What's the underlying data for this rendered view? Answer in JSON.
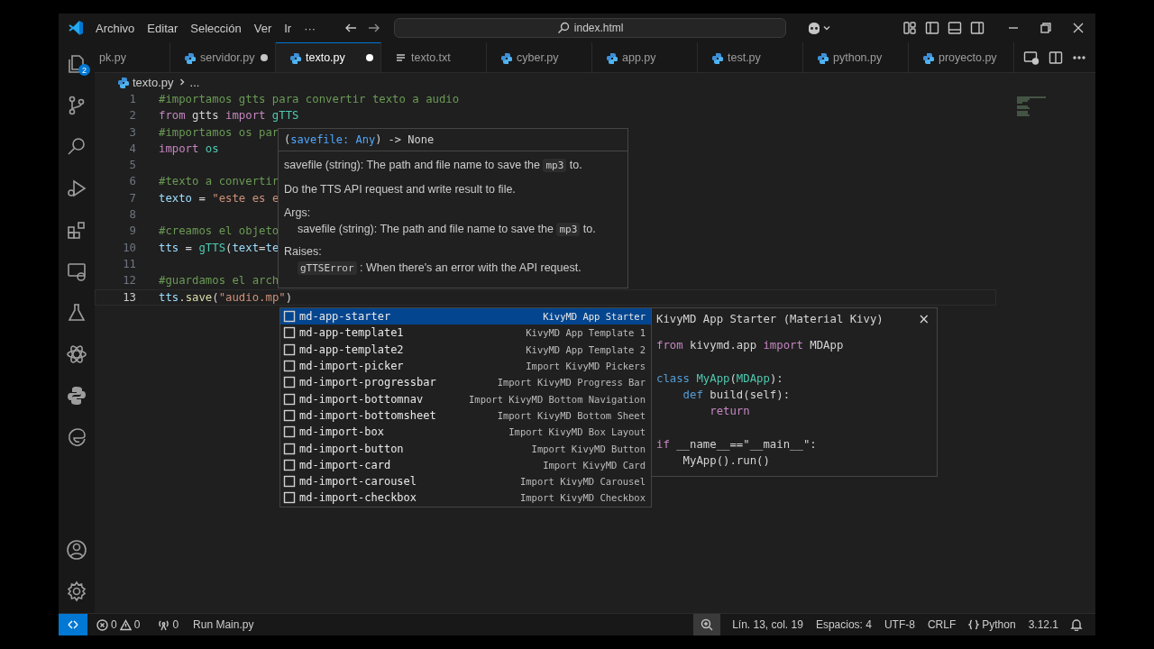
{
  "title_bar": {
    "menu": [
      "Archivo",
      "Editar",
      "Selección",
      "Ver",
      "Ir",
      "···"
    ],
    "search": {
      "value": "index.html"
    }
  },
  "activity_bar": {
    "explorer_badge": "2"
  },
  "tabs": [
    {
      "label": "pk.py",
      "kind": "clipped",
      "selected": false,
      "modified": false
    },
    {
      "label": "servidor.py",
      "kind": "python",
      "selected": false,
      "modified": true
    },
    {
      "label": "texto.py",
      "kind": "python",
      "selected": true,
      "modified": true
    },
    {
      "label": "texto.txt",
      "kind": "text",
      "selected": false,
      "modified": false
    },
    {
      "label": "cyber.py",
      "kind": "python",
      "selected": false,
      "modified": false
    },
    {
      "label": "app.py",
      "kind": "python",
      "selected": false,
      "modified": false
    },
    {
      "label": "test.py",
      "kind": "python",
      "selected": false,
      "modified": false
    },
    {
      "label": "python.py",
      "kind": "python",
      "selected": false,
      "modified": false
    },
    {
      "label": "proyecto.py",
      "kind": "python",
      "selected": false,
      "modified": false
    }
  ],
  "breadcrumb": [
    "texto.py",
    "..."
  ],
  "editor": {
    "lines": [
      {
        "number": "1",
        "active": false,
        "tokens": [
          {
            "text": "#importamos gtts para convertir texto a audio",
            "kind": "comment"
          }
        ]
      },
      {
        "number": "2",
        "active": false,
        "tokens": [
          {
            "text": "from",
            "kind": "keyword"
          },
          {
            "text": " gtts ",
            "kind": "plain"
          },
          {
            "text": "import",
            "kind": "keyword"
          },
          {
            "text": " gTTS",
            "kind": "class"
          }
        ]
      },
      {
        "number": "3",
        "active": false,
        "tokens": [
          {
            "text": "#importamos os par",
            "kind": "comment"
          }
        ]
      },
      {
        "number": "4",
        "active": false,
        "tokens": [
          {
            "text": "import",
            "kind": "keyword"
          },
          {
            "text": " os",
            "kind": "class"
          }
        ]
      },
      {
        "number": "5",
        "active": false
      },
      {
        "number": "6",
        "active": false,
        "tokens": [
          {
            "text": "#texto a convertir",
            "kind": "comment"
          }
        ]
      },
      {
        "number": "7",
        "active": false,
        "tokens": [
          {
            "text": "texto",
            "kind": "variable"
          },
          {
            "text": " = ",
            "kind": "plain"
          },
          {
            "text": "\"este es e",
            "kind": "string"
          }
        ]
      },
      {
        "number": "8",
        "active": false
      },
      {
        "number": "9",
        "active": false,
        "tokens": [
          {
            "text": "#creamos el objeto",
            "kind": "comment"
          }
        ]
      },
      {
        "number": "10",
        "active": false,
        "tokens": [
          {
            "text": "tts",
            "kind": "variable"
          },
          {
            "text": " = ",
            "kind": "plain"
          },
          {
            "text": "gTTS",
            "kind": "class"
          },
          {
            "text": "(",
            "kind": "plain"
          },
          {
            "text": "text",
            "kind": "variable"
          },
          {
            "text": "=",
            "kind": "plain"
          },
          {
            "text": "te",
            "kind": "variable"
          }
        ]
      },
      {
        "number": "11",
        "active": false
      },
      {
        "number": "12",
        "active": false,
        "tokens": [
          {
            "text": "#guardamos el arch",
            "kind": "comment"
          }
        ]
      },
      {
        "number": "13",
        "active": true,
        "tokens": [
          {
            "text": "tts",
            "kind": "variable"
          },
          {
            "text": ".",
            "kind": "plain"
          },
          {
            "text": "save",
            "kind": "function"
          },
          {
            "text": "(",
            "kind": "plain"
          },
          {
            "text": "\"audio.mp\"",
            "kind": "string"
          },
          {
            "text": ")",
            "kind": "plain"
          }
        ]
      }
    ]
  },
  "hover": {
    "signature": [
      {
        "text": "(",
        "kind": "plain"
      },
      {
        "text": "savefile: Any",
        "kind": "param"
      },
      {
        "text": ") -> None",
        "kind": "plain"
      }
    ],
    "paragraphs": [
      {
        "kind": "text",
        "segments": [
          {
            "text": "savefile (string): The path and file name to save the ",
            "kind": "text"
          },
          {
            "text": "mp3",
            "kind": "code"
          },
          {
            "text": " to.",
            "kind": "text"
          }
        ]
      },
      {
        "kind": "text",
        "segments": [
          {
            "text": "Do the TTS API request and write result to file.",
            "kind": "text"
          }
        ]
      },
      {
        "kind": "heading",
        "segments": [
          {
            "text": "Args:",
            "kind": "text"
          }
        ]
      },
      {
        "kind": "indented",
        "segments": [
          {
            "text": "savefile (string): The path and file name to save the ",
            "kind": "text"
          },
          {
            "text": "mp3",
            "kind": "code"
          },
          {
            "text": " to.",
            "kind": "text"
          }
        ]
      },
      {
        "kind": "heading",
        "segments": [
          {
            "text": "Raises:",
            "kind": "text"
          }
        ]
      },
      {
        "kind": "indented",
        "segments": [
          {
            "text": "gTTSError",
            "kind": "code"
          },
          {
            "text": " : When there's an error with the API request.",
            "kind": "text"
          }
        ]
      }
    ]
  },
  "suggest": {
    "items": [
      {
        "label": "md-app-starter",
        "detail": "KivyMD App Starter",
        "selected": true
      },
      {
        "label": "md-app-template1",
        "detail": "KivyMD App Template 1",
        "selected": false
      },
      {
        "label": "md-app-template2",
        "detail": "KivyMD App Template 2",
        "selected": false
      },
      {
        "label": "md-import-picker",
        "detail": "Import KivyMD Pickers",
        "selected": false
      },
      {
        "label": "md-import-progressbar",
        "detail": "Import KivyMD Progress Bar",
        "selected": false
      },
      {
        "label": "md-import-bottomnav",
        "detail": "Import KivyMD Bottom Navigation",
        "selected": false
      },
      {
        "label": "md-import-bottomsheet",
        "detail": "Import KivyMD Bottom Sheet",
        "selected": false
      },
      {
        "label": "md-import-box",
        "detail": "Import KivyMD Box Layout",
        "selected": false
      },
      {
        "label": "md-import-button",
        "detail": "Import KivyMD Button",
        "selected": false
      },
      {
        "label": "md-import-card",
        "detail": "Import KivyMD Card",
        "selected": false
      },
      {
        "label": "md-import-carousel",
        "detail": "Import KivyMD Carousel",
        "selected": false
      },
      {
        "label": "md-import-checkbox",
        "detail": "Import KivyMD Checkbox",
        "selected": false
      }
    ]
  },
  "detail": {
    "title": "KivyMD App Starter (Material Kivy)",
    "close": "×",
    "blocks": [
      [
        {
          "tokens": [
            {
              "text": "from",
              "kind": "keyword"
            },
            {
              "text": " kivymd.app ",
              "kind": "plain"
            },
            {
              "text": "import",
              "kind": "keyword"
            },
            {
              "text": " MDApp",
              "kind": "plain"
            }
          ]
        }
      ],
      [
        {
          "tokens": [
            {
              "text": "class",
              "kind": "storage"
            },
            {
              "text": " MyApp",
              "kind": "class"
            },
            {
              "text": "(",
              "kind": "plain"
            },
            {
              "text": "MDApp",
              "kind": "class"
            },
            {
              "text": "):",
              "kind": "plain"
            }
          ]
        },
        {
          "tokens": [
            {
              "text": "    def",
              "kind": "storage"
            },
            {
              "text": " build(self):",
              "kind": "plain"
            }
          ]
        },
        {
          "tokens": [
            {
              "text": "        return",
              "kind": "keyword"
            }
          ]
        }
      ],
      [
        {
          "tokens": [
            {
              "text": "if",
              "kind": "keyword"
            },
            {
              "text": " __name__==\"__main__\":",
              "kind": "plain"
            }
          ]
        },
        {
          "tokens": [
            {
              "text": "    MyApp().run()",
              "kind": "plain"
            }
          ]
        }
      ]
    ]
  },
  "status_bar": {
    "errors": "0",
    "warnings": "0",
    "ports": "0",
    "run": "Run Main.py",
    "right": [
      {
        "text": "Lín. 13, col. 19"
      },
      {
        "text": "Espacios: 4"
      },
      {
        "text": "UTF-8"
      },
      {
        "text": "CRLF"
      },
      {
        "text": "Python",
        "kind": "language"
      },
      {
        "text": "3.12.1"
      }
    ]
  }
}
